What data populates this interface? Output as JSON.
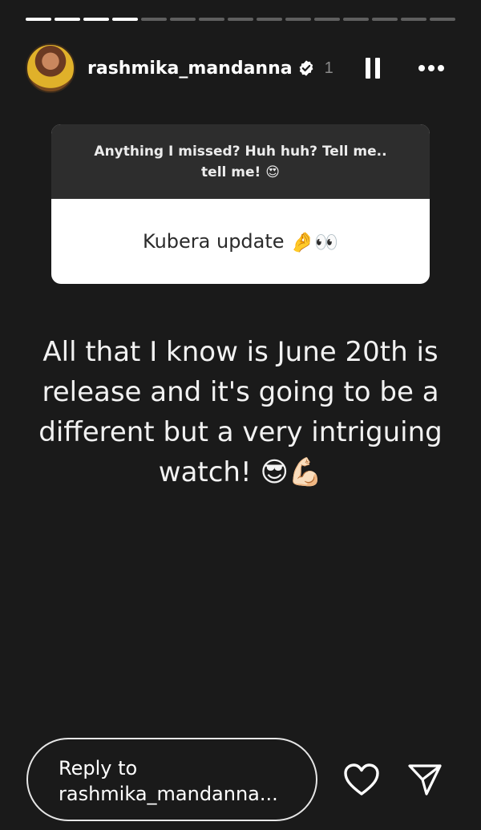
{
  "story": {
    "segments_total": 15,
    "segments_done": 4
  },
  "header": {
    "username": "rashmika_mandanna",
    "time": "1",
    "verified_icon": "verified-badge-icon",
    "pause_icon": "pause-icon",
    "more_icon": "more-options-icon"
  },
  "question_sticker": {
    "question_line1": "Anything I missed? Huh huh? Tell me..",
    "question_line2": "tell me!",
    "question_emoji": "😍",
    "answer": "Kubera update",
    "answer_emojis": "🤌👀"
  },
  "story_text": {
    "line1": "All that I know is June 20th is",
    "line2": "release and it's going to be a",
    "line3": "different but a very intriguing",
    "line4": "watch!",
    "emojis": "😎💪🏻"
  },
  "footer": {
    "reply_line1": "Reply to",
    "reply_line2": "rashmika_mandanna...",
    "like_icon": "heart-icon",
    "send_icon": "send-icon"
  },
  "colors": {
    "background": "#1a1a1a",
    "sticker_top": "#2d2d2d",
    "sticker_bottom": "#ffffff"
  }
}
